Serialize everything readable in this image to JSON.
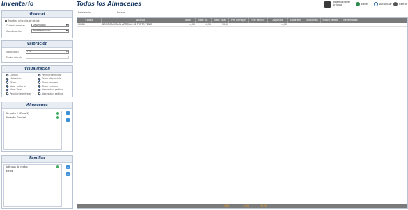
{
  "app_title": "Inventario",
  "main_title": "Todos los Almacenes",
  "toolbar": {
    "stock_label": "Modificaciones Artículo",
    "export_label": "Excel",
    "refresh_label": "Actualizar",
    "close_label": "Cerrar",
    "colors": {
      "excel": "#2e8b4f",
      "refresh": "#2b6cb0",
      "close": "#555555"
    }
  },
  "filters": {
    "warehouse_label": "Referencia",
    "stock_label": "Enlace"
  },
  "general": {
    "title": "General",
    "option_label": "Mostrar artículos sin stock",
    "criteria_label": "Criterio ordenar",
    "criteria_value": "Descripción",
    "combine_label": "Combinación",
    "combine_value": "Predeterminado"
  },
  "valuation": {
    "title": "Valoración",
    "method_label": "Valoración",
    "method_value": "PMP",
    "date_label": "Fecha cálculo",
    "date_value": ""
  },
  "display": {
    "title": "Visualización",
    "left": [
      {
        "label": "Código",
        "checked": true
      },
      {
        "label": "Ubicación",
        "checked": true
      },
      {
        "label": "Stock",
        "checked": true
      },
      {
        "label": "Valor unitario",
        "checked": true
      },
      {
        "label": "Valor Total",
        "checked": true
      },
      {
        "label": "Pendiente entrega",
        "checked": true
      }
    ],
    "right": [
      {
        "label": "Pendiente recibir",
        "checked": true
      },
      {
        "label": "Stock disponible",
        "checked": true
      },
      {
        "label": "Stock mínimo",
        "checked": true
      },
      {
        "label": "Stock máximo",
        "checked": true
      },
      {
        "label": "Necesidad pedido",
        "checked": true
      },
      {
        "label": "Necesidad pedido",
        "checked": true
      }
    ]
  },
  "warehouses": {
    "title": "Almacenes",
    "items": [
      "Almacén 2 (Zona 1)",
      "Almacén General"
    ]
  },
  "families": {
    "title": "Familias",
    "items": [
      "Artículos de recibo",
      "Bonos"
    ]
  },
  "grid": {
    "columns": [
      "Código",
      "Artículo",
      "Stock",
      "Valor Ud.",
      "Valor Total",
      "Pte. Entregar",
      "Pte. Recibir",
      "Disponible",
      "Stock Mín",
      "Stock Máx",
      "Nuevo pedido",
      "Necesidades"
    ],
    "rows": [
      [
        "00080",
        "BONIFICACIÓN AL ARTÍCULO DE PUNTO VENTA",
        "-4,00",
        "-0,10",
        "30,00",
        "",
        "",
        "-4,00",
        "",
        "",
        "",
        ""
      ]
    ],
    "footer": [
      "-4,00",
      "-0,10",
      "30,00"
    ]
  }
}
